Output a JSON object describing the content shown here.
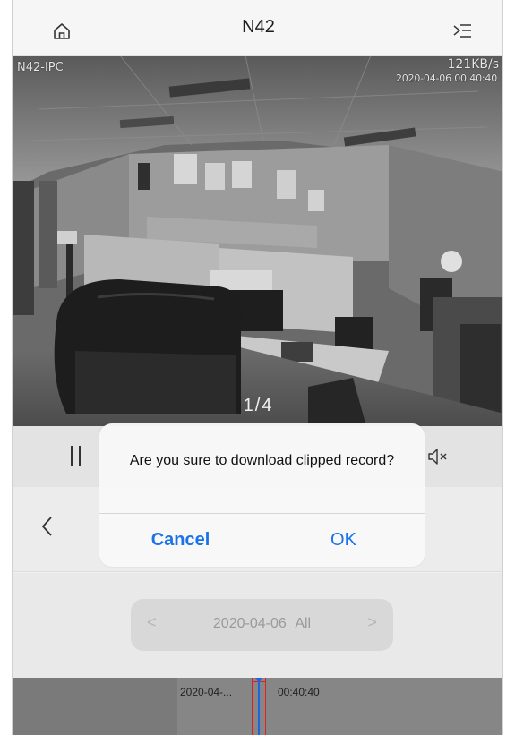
{
  "header": {
    "title": "N42",
    "left_icon": "home-icon",
    "right_icon": "menu-list-icon"
  },
  "video": {
    "osd_name": "N42-IPC",
    "osd_rate": "121KB/s",
    "osd_time": "2020-04-06 00:40:40",
    "page_indicator": "1/4"
  },
  "controls": {
    "pause_icon": "pause-icon",
    "mute_icon": "speaker-muted-icon"
  },
  "nav": {
    "back_icon": "chevron-left-icon"
  },
  "date_selector": {
    "prev": "<",
    "next": ">",
    "text": "2020-04-06 All"
  },
  "timeline": {
    "date_label": "2020-04-...",
    "time_label": "00:40:40"
  },
  "dialog": {
    "message": "Are you sure to download clipped record?",
    "cancel_label": "Cancel",
    "ok_label": "OK"
  },
  "colors": {
    "accent": "#1a73e8",
    "cursor_blue": "#1e63e0",
    "cursor_red": "#e02020"
  }
}
